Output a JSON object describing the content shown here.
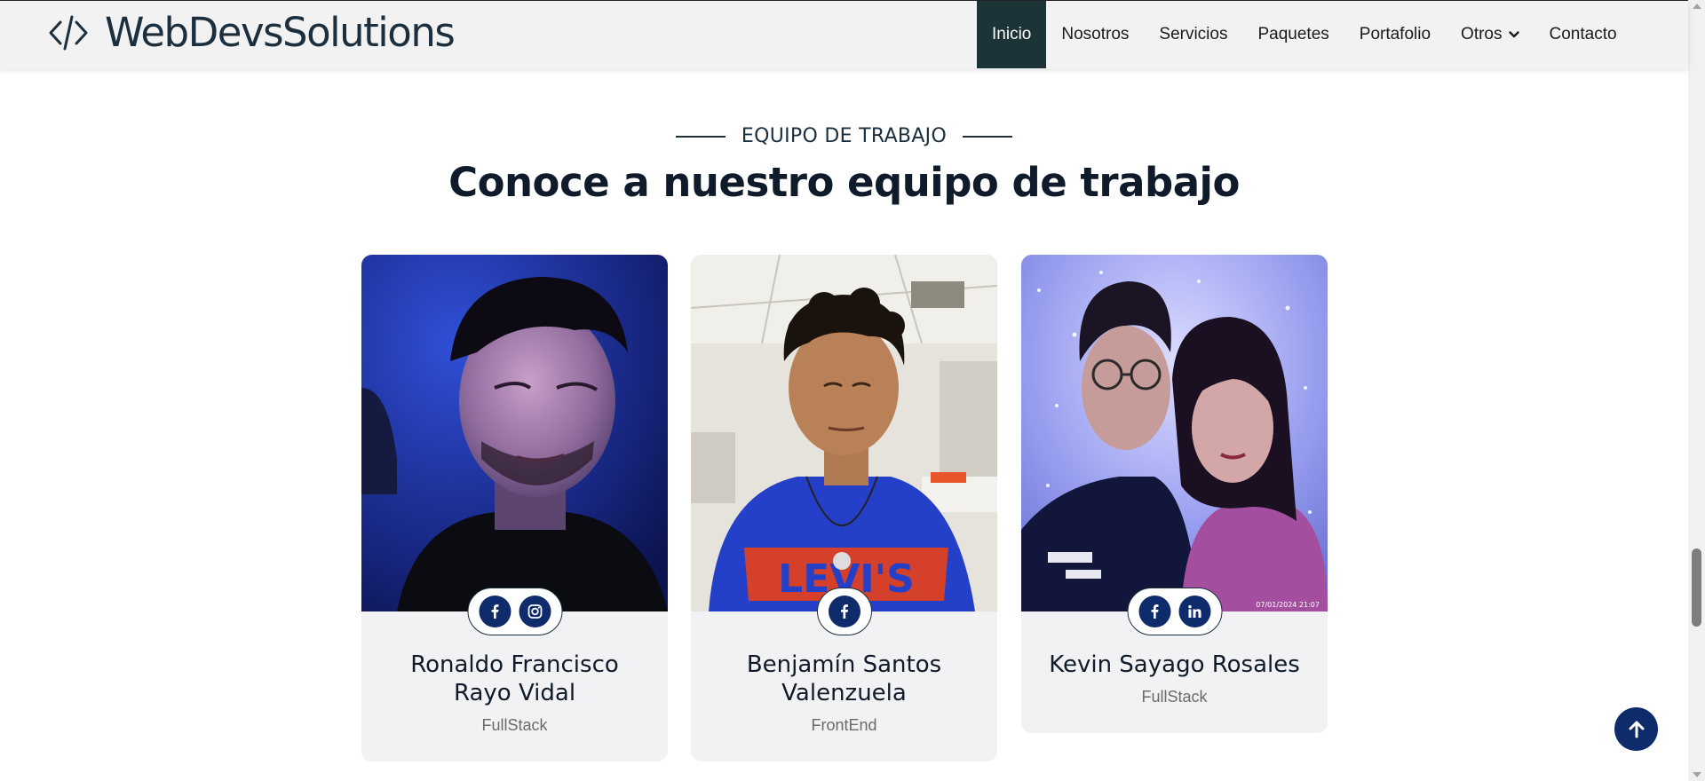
{
  "brand": {
    "name": "WebDevsSolutions",
    "icon": "code-brackets-icon"
  },
  "nav": {
    "items": [
      {
        "label": "Inicio",
        "active": true
      },
      {
        "label": "Nosotros",
        "active": false
      },
      {
        "label": "Servicios",
        "active": false
      },
      {
        "label": "Paquetes",
        "active": false
      },
      {
        "label": "Portafolio",
        "active": false
      },
      {
        "label": "Otros",
        "active": false,
        "dropdown": true
      },
      {
        "label": "Contacto",
        "active": false
      }
    ]
  },
  "section": {
    "subtitle": "EQUIPO DE TRABAJO",
    "title": "Conoce a nuestro equipo de trabajo"
  },
  "team": [
    {
      "name": "Ronaldo Francisco Rayo Vidal",
      "role": "FullStack",
      "socials": [
        "facebook-icon",
        "instagram-icon"
      ]
    },
    {
      "name": "Benjamín Santos Valenzuela",
      "role": "FrontEnd",
      "socials": [
        "facebook-icon"
      ]
    },
    {
      "name": "Kevin Sayago Rosales",
      "role": "FullStack",
      "socials": [
        "facebook-icon",
        "linkedin-icon"
      ]
    }
  ],
  "photo_stamp": "07/01/2024 21:07",
  "colors": {
    "accent": "#0e2b6b",
    "nav_active": "#1c3338",
    "text_dark": "#0f1b2a",
    "card_bg": "#f2f2f4"
  }
}
